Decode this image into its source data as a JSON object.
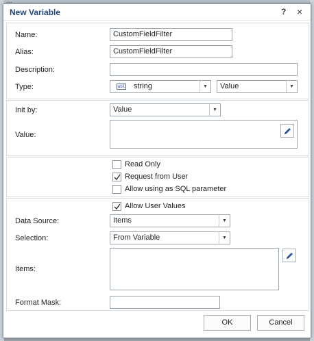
{
  "background": {
    "strip_text": "..."
  },
  "dialog": {
    "title": "New Variable",
    "help_label": "?",
    "close_label": "×"
  },
  "fields": {
    "name": {
      "label": "Name:",
      "value": "CustomFieldFilter"
    },
    "alias": {
      "label": "Alias:",
      "value": "CustomFieldFilter"
    },
    "description": {
      "label": "Description:",
      "value": ""
    },
    "type": {
      "label": "Type:",
      "icon_text": "abl",
      "value": "string",
      "kind_value": "Value"
    },
    "init_by": {
      "label": "Init by:",
      "value": "Value"
    },
    "value": {
      "label": "Value:",
      "value": ""
    },
    "data_source": {
      "label": "Data Source:",
      "value": "Items"
    },
    "selection": {
      "label": "Selection:",
      "value": "From Variable"
    },
    "items": {
      "label": "Items:",
      "value": ""
    },
    "format_mask": {
      "label": "Format Mask:",
      "value": ""
    }
  },
  "options": {
    "read_only": {
      "label": "Read Only",
      "checked": false
    },
    "request_from_user": {
      "label": "Request from User",
      "checked": true
    },
    "allow_sql_parameter": {
      "label": "Allow using as SQL parameter",
      "checked": false
    },
    "allow_user_values": {
      "label": "Allow User Values",
      "checked": true
    }
  },
  "buttons": {
    "ok": "OK",
    "cancel": "Cancel"
  },
  "icons": {
    "dropdown": "chevron-down-icon",
    "edit": "pencil-icon",
    "check": "checkmark-icon",
    "type": "string-type-icon"
  },
  "colors": {
    "title": "#27467a",
    "pencil": "#2b5a9a",
    "check": "#333333"
  }
}
